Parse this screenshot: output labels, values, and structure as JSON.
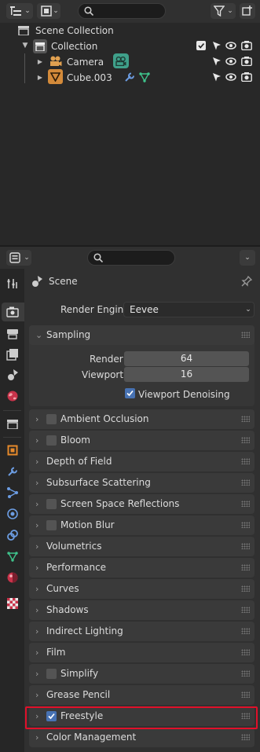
{
  "outliner": {
    "search_placeholder": "",
    "items": [
      {
        "label": "Scene Collection"
      },
      {
        "label": "Collection"
      },
      {
        "label": "Camera"
      },
      {
        "label": "Cube.003"
      }
    ]
  },
  "properties": {
    "search_placeholder": "",
    "context": "Scene",
    "render_engine_label": "Render Engine",
    "render_engine_value": "Eevee",
    "sampling": {
      "title": "Sampling",
      "render_label": "Render",
      "render_value": "64",
      "viewport_label": "Viewport",
      "viewport_value": "16",
      "denoise_label": "Viewport Denoising"
    },
    "panels": [
      {
        "label": "Ambient Occlusion",
        "checkbox": true,
        "checked": false
      },
      {
        "label": "Bloom",
        "checkbox": true,
        "checked": false
      },
      {
        "label": "Depth of Field",
        "checkbox": false
      },
      {
        "label": "Subsurface Scattering",
        "checkbox": false
      },
      {
        "label": "Screen Space Reflections",
        "checkbox": true,
        "checked": false
      },
      {
        "label": "Motion Blur",
        "checkbox": true,
        "checked": false
      },
      {
        "label": "Volumetrics",
        "checkbox": false
      },
      {
        "label": "Performance",
        "checkbox": false
      },
      {
        "label": "Curves",
        "checkbox": false
      },
      {
        "label": "Shadows",
        "checkbox": false
      },
      {
        "label": "Indirect Lighting",
        "checkbox": false
      },
      {
        "label": "Film",
        "checkbox": false
      },
      {
        "label": "Simplify",
        "checkbox": true,
        "checked": false
      },
      {
        "label": "Grease Pencil",
        "checkbox": false
      },
      {
        "label": "Freestyle",
        "checkbox": true,
        "checked": true
      },
      {
        "label": "Color Management",
        "checkbox": false
      }
    ]
  },
  "colors": {
    "accent_blue": "#4772b3",
    "highlight_red": "#e0102a",
    "camera_orange": "#e0a050",
    "camera_green": "#3fa08a"
  }
}
